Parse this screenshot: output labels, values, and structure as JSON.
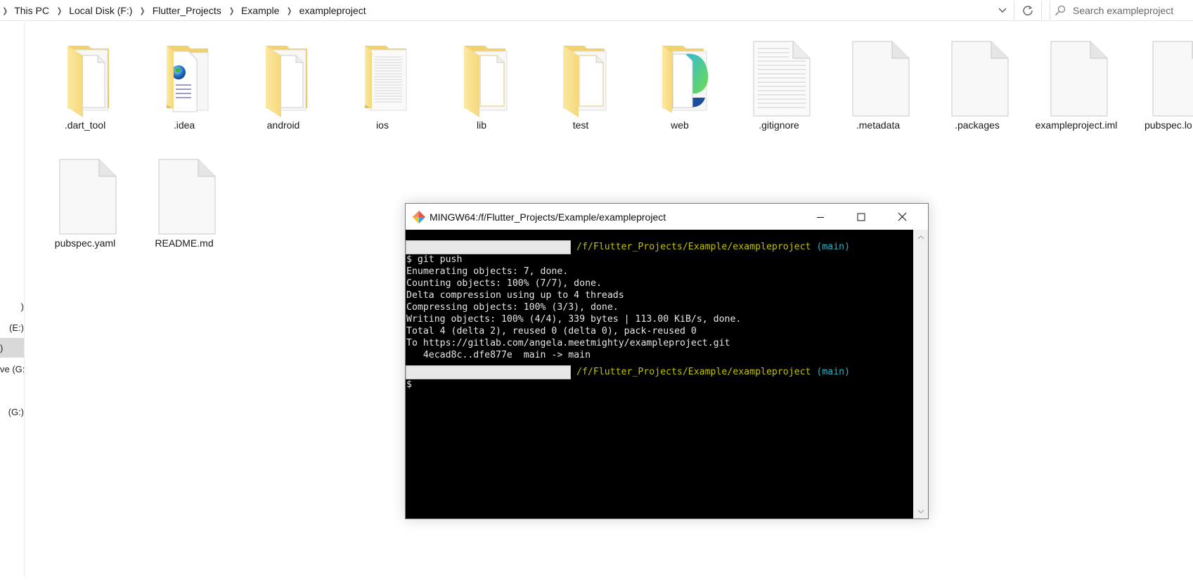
{
  "address_bar": {
    "breadcrumbs": [
      "This PC",
      "Local Disk (F:)",
      "Flutter_Projects",
      "Example",
      "exampleproject"
    ],
    "dropdown_icon": "chevron-down-icon",
    "refresh_icon": "refresh-icon",
    "search": {
      "placeholder": "Search exampleproject",
      "value": ""
    }
  },
  "nav_pane": {
    "items": [
      {
        "label": ")",
        "selected": false
      },
      {
        "label": "(E:)",
        "selected": false
      },
      {
        "label": ")",
        "selected": true
      },
      {
        "label": "ve (G:",
        "selected": false
      },
      {
        "label": "(G:)",
        "selected": false
      }
    ]
  },
  "files": [
    {
      "name": ".dart_tool",
      "type": "folder",
      "icon": "folder-icon"
    },
    {
      "name": ".idea",
      "type": "folder",
      "icon": "folder-web-doc-icon"
    },
    {
      "name": "android",
      "type": "folder",
      "icon": "folder-icon"
    },
    {
      "name": "ios",
      "type": "folder",
      "icon": "folder-text-icon"
    },
    {
      "name": "lib",
      "type": "folder",
      "icon": "folder-icon"
    },
    {
      "name": "test",
      "type": "folder",
      "icon": "folder-icon"
    },
    {
      "name": "web",
      "type": "folder",
      "icon": "folder-edge-icon"
    },
    {
      "name": ".gitignore",
      "type": "file",
      "icon": "text-file-icon"
    },
    {
      "name": ".metadata",
      "type": "file",
      "icon": "blank-file-icon"
    },
    {
      "name": ".packages",
      "type": "file",
      "icon": "blank-file-icon"
    },
    {
      "name": "exampleproject.iml",
      "type": "file",
      "icon": "blank-file-icon"
    },
    {
      "name": "pubspec.lo",
      "type": "file",
      "icon": "blank-file-icon"
    },
    {
      "name": "pubspec.yaml",
      "type": "file",
      "icon": "blank-file-icon"
    },
    {
      "name": "README.md",
      "type": "file",
      "icon": "blank-file-icon"
    }
  ],
  "terminal": {
    "title": "MINGW64:/f/Flutter_Projects/Example/exampleproject",
    "prompt_path": "/f/Flutter_Projects/Example/exampleproject",
    "prompt_branch": "(main)",
    "command": "$ git push",
    "output": [
      "Enumerating objects: 7, done.",
      "Counting objects: 100% (7/7), done.",
      "Delta compression using up to 4 threads",
      "Compressing objects: 100% (3/3), done.",
      "Writing objects: 100% (4/4), 339 bytes | 113.00 KiB/s, done.",
      "Total 4 (delta 2), reused 0 (delta 0), pack-reused 0",
      "To https://gitlab.com/angela.meetmighty/exampleproject.git",
      "   4ecad8c..dfe877e  main -> main"
    ],
    "cursor_prompt": "$",
    "colors": {
      "path": "#c0c000",
      "branch": "#22b5c9",
      "background": "#000000",
      "text": "#e6e6e6"
    }
  }
}
